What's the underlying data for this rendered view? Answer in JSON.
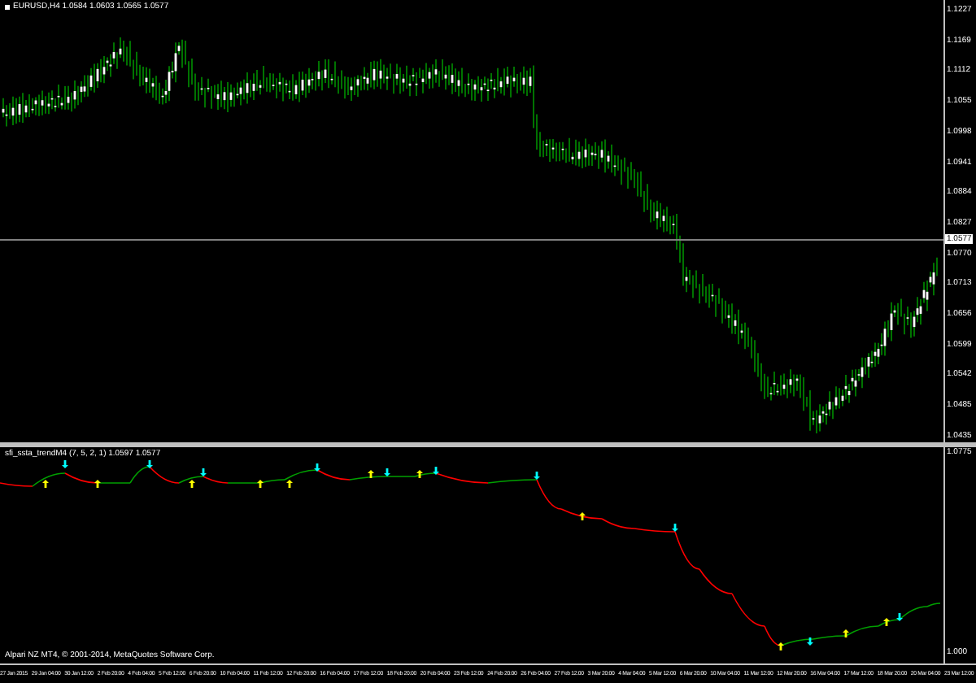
{
  "main_chart": {
    "title": "EURUSD,H4  1.0584 1.0603 1.0565 1.0577",
    "current_price": "1.0577",
    "price_axis": [
      "1.1227",
      "1.1169",
      "1.1112",
      "1.1055",
      "1.0998",
      "1.0941",
      "1.0884",
      "1.0827",
      "1.0770",
      "1.0713",
      "1.0656",
      "1.0599",
      "1.0542",
      "1.0485",
      "1.0435"
    ]
  },
  "indicator": {
    "label": "sfi_ssta_trendM4 (7, 5, 2, 1)  1.0597 1.0577",
    "axis": [
      "1.0775",
      "1.000"
    ],
    "footer": "Alpari NZ MT4, © 2001-2014, MetaQuotes Software Corp."
  },
  "time_axis": [
    "27 Jan 2015",
    "29 Jan 04:00",
    "30 Jan 12:00",
    "2 Feb 20:00",
    "4 Feb 04:00",
    "5 Feb 12:00",
    "6 Feb 20:00",
    "10 Feb 04:00",
    "11 Feb 12:00",
    "12 Feb 20:00",
    "16 Feb 04:00",
    "17 Feb 12:00",
    "18 Feb 20:00",
    "20 Feb 04:00",
    "23 Feb 12:00",
    "24 Feb 20:00",
    "26 Feb 04:00",
    "27 Feb 12:00",
    "3 Mar 20:00",
    "4 Mar 04:00",
    "5 Mar 12:00",
    "6 Mar 20:00",
    "10 Mar 04:00",
    "11 Mar 12:00",
    "12 Mar 20:00",
    "16 Mar 04:00",
    "17 Mar 12:00",
    "18 Mar 20:00",
    "20 Mar 04:00",
    "23 Mar 12:00"
  ]
}
